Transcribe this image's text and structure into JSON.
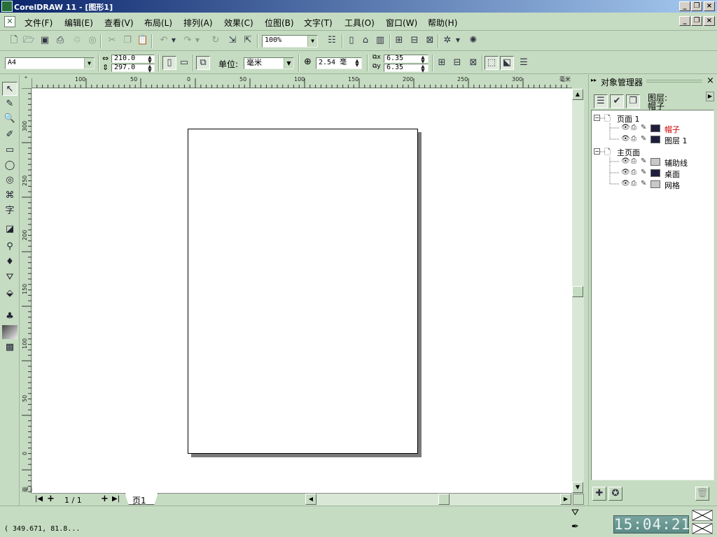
{
  "window": {
    "title": "CorelDRAW 11 - [图形1]",
    "controls": [
      "_",
      "❐",
      "×"
    ]
  },
  "menu": {
    "items": [
      "文件(F)",
      "编辑(E)",
      "查看(V)",
      "布局(L)",
      "排列(A)",
      "效果(C)",
      "位图(B)",
      "文字(T)",
      "工具(O)",
      "窗口(W)",
      "帮助(H)"
    ]
  },
  "toolbar": {
    "zoom_value": "100%"
  },
  "property_bar": {
    "paper_size": "A4",
    "width": "210.0",
    "height": "297.0",
    "units_label": "单位:",
    "units_value": "毫米",
    "nudge_value": "2.54 毫",
    "dup_x": "6.35",
    "dup_y": "6.35"
  },
  "ruler": {
    "unit": "毫米",
    "h_ticks": [
      "100",
      "50",
      "0",
      "50",
      "100",
      "150",
      "200",
      "250",
      "300"
    ],
    "v_ticks": [
      "300",
      "250",
      "200",
      "150",
      "100",
      "50",
      "0"
    ]
  },
  "page_nav": {
    "page_count": "1 / 1",
    "page_tab": "页1"
  },
  "object_manager": {
    "title": "对象管理器",
    "header_label": "图层:",
    "current_layer": "帽子",
    "tree": [
      {
        "label": "页面 1",
        "type": "page"
      },
      {
        "label": "帽子",
        "type": "layer",
        "color": "#1e1e3c",
        "label_color": "#cc0000"
      },
      {
        "label": "图层 1",
        "type": "layer",
        "color": "#1e1e3c",
        "label_color": "#000000"
      },
      {
        "label": "主页面",
        "type": "page"
      },
      {
        "label": "辅助线",
        "type": "layer",
        "color": "#c8c8c8",
        "label_color": "#000000"
      },
      {
        "label": "桌面",
        "type": "layer",
        "color": "#1e1e3c",
        "label_color": "#000000"
      },
      {
        "label": "网格",
        "type": "layer",
        "color": "#c8c8c8",
        "label_color": "#000000"
      }
    ]
  },
  "status": {
    "coordinates": "( 349.671, 81.8..."
  },
  "clock": {
    "time": "15:04:21"
  }
}
